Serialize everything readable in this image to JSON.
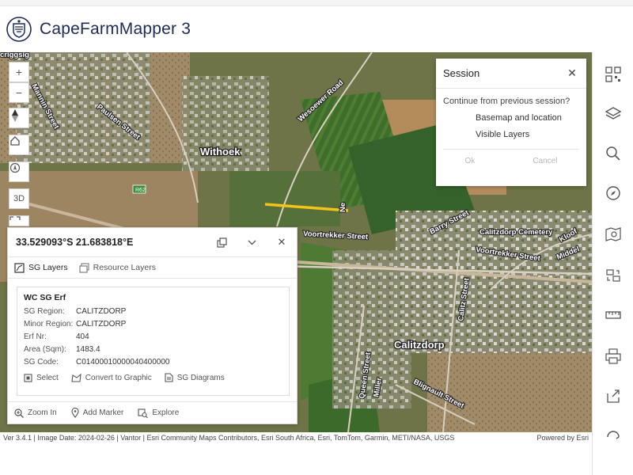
{
  "app": {
    "title": "CapeFarmMapper 3"
  },
  "map": {
    "labels": {
      "withoek": "Withoek",
      "calitzdorp": "Calitzdorp",
      "wesoewer_road": "Wesoewer Road",
      "mannin_street": "Mannin Street",
      "paulsen_street": "Paulsen Street",
      "voortrekker_street": "Voortrekker Street",
      "barry_street": "Barry Street",
      "calitzdorp_cemetery": "Calitzdorp Cemetery",
      "voortrekker_street_2": "Voortrekker Street",
      "kloof": "Kloof",
      "middel": "Middel",
      "calitz_street": "Calitz Street",
      "queen_street": "Queen Street",
      "miller": "Miller",
      "blignault_street": "Blignault Street",
      "r62": "R62",
      "top_left_fragment": "criggsig",
      "short_road": "Ne"
    },
    "controls": {
      "zoom_in": "+",
      "zoom_out": "−",
      "three_d": "3D"
    }
  },
  "info_panel": {
    "coords": "33.529093°S 21.683818°E",
    "tabs": {
      "sg_layers": "SG Layers",
      "resource_layers": "Resource Layers"
    },
    "card": {
      "title": "WC SG Erf",
      "fields": [
        {
          "key": "SG Region:",
          "value": "CALITZDORP"
        },
        {
          "key": "Minor Region:",
          "value": "CALITZDORP"
        },
        {
          "key": "Erf Nr:",
          "value": "404"
        },
        {
          "key": "Area (Sqm):",
          "value": "1483.4"
        },
        {
          "key": "SG Code:",
          "value": "C01400010000040400000"
        }
      ],
      "actions": {
        "select": "Select",
        "convert": "Convert to Graphic",
        "diagrams": "SG Diagrams"
      }
    },
    "footer": {
      "zoom_in": "Zoom In",
      "add_marker": "Add Marker",
      "explore": "Explore"
    }
  },
  "session_dialog": {
    "title": "Session",
    "question": "Continue from previous session?",
    "options": [
      "Basemap and location",
      "Visible Layers"
    ],
    "ok": "Ok",
    "cancel": "Cancel"
  },
  "attribution": {
    "left": "Ver 3.4.1 | Image Date: 2024-02-26 | Vantor | Esri Community Maps Contributors, Esri South Africa, Esri, TomTom, Garmin, METI/NASA, USGS",
    "right": "Powered by Esri"
  },
  "icons": {
    "right_bar": [
      "qr-code-icon",
      "layers-icon",
      "search-icon",
      "compass-icon",
      "map-search-icon",
      "transfer-icon",
      "measure-icon",
      "print-icon",
      "share-icon",
      "support-icon"
    ]
  }
}
